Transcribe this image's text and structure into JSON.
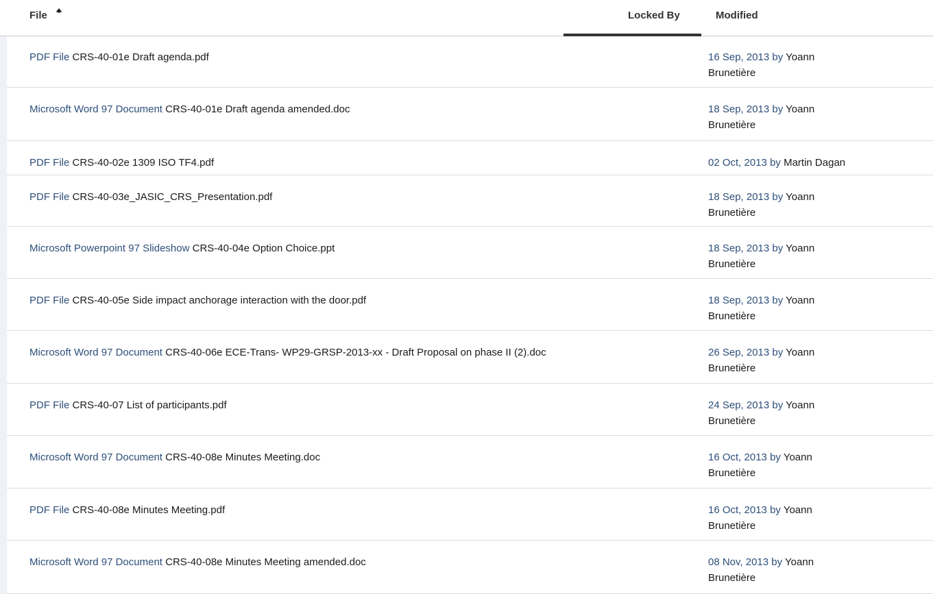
{
  "header": {
    "file_label": "File",
    "locked_by_label": "Locked By",
    "modified_label": "Modified",
    "sort_icon": "sort-ascending-icon"
  },
  "colors": {
    "link": "#2e4f7a",
    "text": "#1a1a1a",
    "divider": "#dcdcdc",
    "active_sort_bar": "#333333"
  },
  "rows": [
    {
      "type": "PDF File",
      "name": "CRS-40-01e Draft agenda.pdf",
      "date": "16 Sep, 2013",
      "by": "by",
      "author_first": "Yoann",
      "author_last": "Brunetière"
    },
    {
      "type": "Microsoft Word 97 Document",
      "name": "CRS-40-01e Draft agenda amended.doc",
      "date": "18 Sep, 2013",
      "by": "by",
      "author_first": "Yoann",
      "author_last": "Brunetière"
    },
    {
      "type": "PDF File",
      "name": "CRS-40-02e 1309 ISO TF4.pdf",
      "date": "02 Oct, 2013",
      "by": "by",
      "author_first": "Martin Dagan",
      "author_last": ""
    },
    {
      "type": "PDF File",
      "name": "CRS-40-03e_JASIC_CRS_Presentation.pdf",
      "date": "18 Sep, 2013",
      "by": "by",
      "author_first": "Yoann",
      "author_last": "Brunetière"
    },
    {
      "type": "Microsoft Powerpoint 97 Slideshow",
      "name": "CRS-40-04e Option Choice.ppt",
      "date": "18 Sep, 2013",
      "by": "by",
      "author_first": "Yoann",
      "author_last": "Brunetière"
    },
    {
      "type": "PDF File",
      "name": "CRS-40-05e Side impact anchorage interaction with the door.pdf",
      "date": "18 Sep, 2013",
      "by": "by",
      "author_first": "Yoann",
      "author_last": "Brunetière"
    },
    {
      "type": "Microsoft Word 97 Document",
      "name": "CRS-40-06e ECE-Trans- WP29-GRSP-2013-xx - Draft Proposal on phase II (2).doc",
      "date": "26 Sep, 2013",
      "by": "by",
      "author_first": "Yoann",
      "author_last": "Brunetière"
    },
    {
      "type": "PDF File",
      "name": "CRS-40-07 List of participants.pdf",
      "date": "24 Sep, 2013",
      "by": "by",
      "author_first": "Yoann",
      "author_last": "Brunetière"
    },
    {
      "type": "Microsoft Word 97 Document",
      "name": "CRS-40-08e Minutes Meeting.doc",
      "date": "16 Oct, 2013",
      "by": "by",
      "author_first": "Yoann",
      "author_last": "Brunetière"
    },
    {
      "type": "PDF File",
      "name": "CRS-40-08e Minutes Meeting.pdf",
      "date": "16 Oct, 2013",
      "by": "by",
      "author_first": "Yoann",
      "author_last": "Brunetière"
    },
    {
      "type": "Microsoft Word 97 Document",
      "name": "CRS-40-08e Minutes Meeting amended.doc",
      "date": "08 Nov, 2013",
      "by": "by",
      "author_first": "Yoann",
      "author_last": "Brunetière"
    }
  ]
}
